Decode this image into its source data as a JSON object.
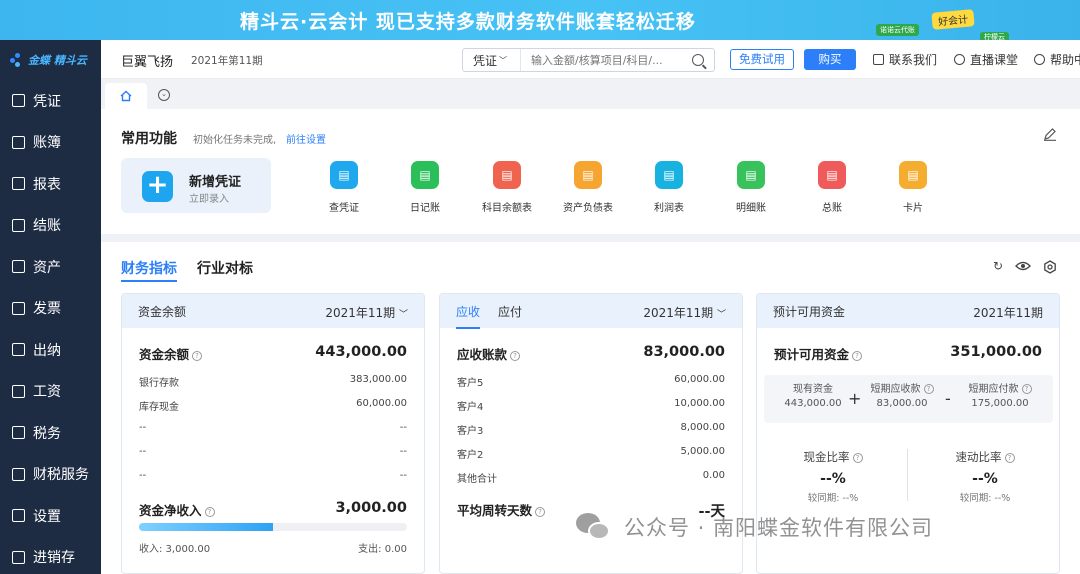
{
  "banner": {
    "text": "精斗云·云会计  现已支持多款财务软件账套轻松迁移",
    "badge_main": "好会计",
    "badge_small1": "诺诺云代账",
    "badge_small2": "柠檬云"
  },
  "sidebar": {
    "logo": "金蝶 精斗云",
    "items": [
      {
        "label": "凭证",
        "icon": "voucher-icon"
      },
      {
        "label": "账簿",
        "icon": "ledger-icon"
      },
      {
        "label": "报表",
        "icon": "report-icon"
      },
      {
        "label": "结账",
        "icon": "closing-icon"
      },
      {
        "label": "资产",
        "icon": "asset-icon"
      },
      {
        "label": "发票",
        "icon": "invoice-icon"
      },
      {
        "label": "出纳",
        "icon": "cashier-icon"
      },
      {
        "label": "工资",
        "icon": "salary-icon"
      },
      {
        "label": "税务",
        "icon": "tax-icon"
      },
      {
        "label": "财税服务",
        "icon": "service-icon"
      },
      {
        "label": "设置",
        "icon": "settings-icon"
      },
      {
        "label": "进销存",
        "icon": "inventory-icon"
      }
    ]
  },
  "header": {
    "company": "巨翼飞扬",
    "period": "2021年第11期",
    "search_select": "凭证",
    "search_placeholder": "输入金额/核算项目/科目/...",
    "try_label": "免费试用",
    "buy_label": "购买",
    "contact_label": "联系我们",
    "live_label": "直播课堂",
    "help_label": "帮助中"
  },
  "common": {
    "title": "常用功能",
    "hint": "初始化任务未完成,",
    "link": "前往设置",
    "new_voucher": {
      "title": "新增凭证",
      "subtitle": "立即录入"
    },
    "functions": [
      {
        "label": "查凭证",
        "color": "#1fa8ee",
        "icon": "query-voucher-icon"
      },
      {
        "label": "日记账",
        "color": "#2bbf5a",
        "icon": "journal-icon"
      },
      {
        "label": "科目余额表",
        "color": "#f0634f",
        "icon": "balance-sheet-icon"
      },
      {
        "label": "资产负债表",
        "color": "#f7a531",
        "icon": "assets-liabilities-icon"
      },
      {
        "label": "利润表",
        "color": "#18b2e0",
        "icon": "profit-icon"
      },
      {
        "label": "明细账",
        "color": "#37c25c",
        "icon": "detail-ledger-icon"
      },
      {
        "label": "总账",
        "color": "#ef5a5a",
        "icon": "general-ledger-icon"
      },
      {
        "label": "卡片",
        "color": "#f5ad2f",
        "icon": "card-icon"
      }
    ]
  },
  "finance": {
    "tab_active": "财务指标",
    "tab_other": "行业对标",
    "funds": {
      "header": "资金余额",
      "period": "2021年11期",
      "main_label": "资金余额",
      "main_value": "443,000.00",
      "rows": [
        {
          "label": "银行存款",
          "value": "383,000.00"
        },
        {
          "label": "库存现金",
          "value": "60,000.00"
        },
        {
          "label": "--",
          "value": "--"
        },
        {
          "label": "--",
          "value": "--"
        },
        {
          "label": "--",
          "value": "--"
        }
      ],
      "net_label": "资金净收入",
      "net_value": "3,000.00",
      "progress": 0.5,
      "income_label": "收入: 3,000.00",
      "expense_label": "支出: 0.00"
    },
    "receivable": {
      "tab_active": "应收",
      "tab_other": "应付",
      "period": "2021年11期",
      "main_label": "应收账款",
      "main_value": "83,000.00",
      "rows": [
        {
          "label": "客户5",
          "value": "60,000.00"
        },
        {
          "label": "客户4",
          "value": "10,000.00"
        },
        {
          "label": "客户3",
          "value": "8,000.00"
        },
        {
          "label": "客户2",
          "value": "5,000.00"
        },
        {
          "label": "其他合计",
          "value": "0.00"
        }
      ],
      "turnover_label": "平均周转天数",
      "turnover_value": "--天"
    },
    "available": {
      "header": "预计可用资金",
      "period": "2021年11期",
      "main_label": "预计可用资金",
      "main_value": "351,000.00",
      "c1_label": "现有资金",
      "c1_value": "443,000.00",
      "c2_label": "短期应收款",
      "c2_value": "83,000.00",
      "c3_label": "短期应付款",
      "c3_value": "175,000.00",
      "plus": "+",
      "minus": "-",
      "cash_ratio_label": "现金比率",
      "cash_ratio_value": "--%",
      "cash_ratio_sub": "较同期: --%",
      "quick_ratio_label": "速动比率",
      "quick_ratio_value": "--%",
      "quick_ratio_sub": "较同期: --%"
    }
  },
  "watermark": "公众号 · 南阳蝶金软件有限公司"
}
